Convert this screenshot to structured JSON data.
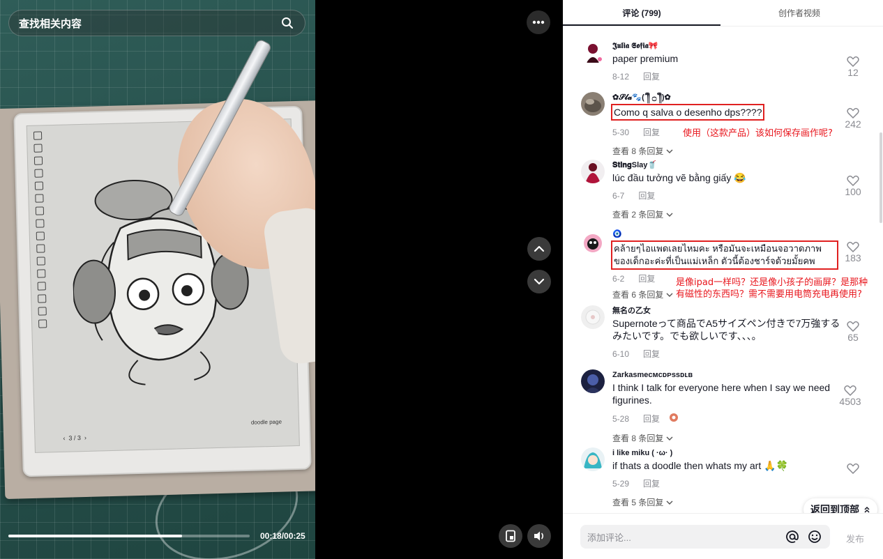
{
  "video": {
    "search_placeholder": "查找相关内容",
    "time_display": "00:18/00:25",
    "progress_fraction": 0.72,
    "screen_label": "doodle page",
    "page_indicator": "3 / 3"
  },
  "tabs": [
    {
      "label": "评论 (799)",
      "active": true
    },
    {
      "label": "创作者视频",
      "active": false
    }
  ],
  "comments": [
    {
      "name": "𝕵𝖚𝖑𝖎𝖆 𝕾𝖔𝖋𝖎𝖆🎀",
      "text": "paper premium",
      "date": "8-12",
      "reply_label": "回复",
      "likes": "12",
      "view_replies": ""
    },
    {
      "name": "✿𝓢𝓵𝓪🐾(´༎ຶ ۝ ༎ຶ)✿",
      "text": "Como q salva o desenho dps????",
      "date": "5-30",
      "reply_label": "回复",
      "likes": "242",
      "view_replies": "查看 8 条回复"
    },
    {
      "name": "𝐒𝐭𝐢𝐧𝐠Slay🥤",
      "text": "lúc đầu tưởng vẽ bằng giấy 😂",
      "date": "6-7",
      "reply_label": "回复",
      "likes": "100",
      "view_replies": "查看 2 条回复"
    },
    {
      "name": "🧿",
      "text": "คล้ายๆไอแพดเลยไหมคะ หรือมันจะเหมือนจอวาดภาพของเด็กอะค่ะที่เป็นแม่เหล็ก ตัวนี้ต้องชาร์จด้วยมั้ยคพ",
      "date": "6-2",
      "reply_label": "回复",
      "likes": "183",
      "view_replies": "查看 6 条回复"
    },
    {
      "name": "無名の乙女",
      "text": "Supernoteって商品でA5サイズペン付きで7万強するみたいです。でも欲しいです、、、。",
      "date": "6-10",
      "reply_label": "回复",
      "likes": "65",
      "view_replies": ""
    },
    {
      "name": "Zarkasmecᴍᴄᴅᴘssᴅʟʙ",
      "text": "I think I talk for everyone here when I say we need figurines.",
      "date": "5-28",
      "reply_label": "回复",
      "likes": "4503",
      "view_replies": "查看 8 条回复"
    },
    {
      "name": "i like miku ( ·ω· )",
      "text": "if thats a doodle then whats my art 🙏🍀",
      "date": "5-29",
      "reply_label": "回复",
      "likes": "",
      "view_replies": "查看 5 条回复"
    }
  ],
  "annotations": {
    "note_1": "使用（这款产品）该如何保存画作呢?",
    "note_2_line1": "是像ipad一样吗？还是像小孩子的画屏？是那种",
    "note_2_line2": "有磁性的东西吗？需不需要用电筒充电再使用?"
  },
  "back_to_top": "返回到顶部",
  "composer": {
    "placeholder": "添加评论...",
    "post_label": "发布"
  },
  "colors": {
    "highlight": "#e02020",
    "annotation": "#e8161d",
    "accent": "#161823"
  }
}
